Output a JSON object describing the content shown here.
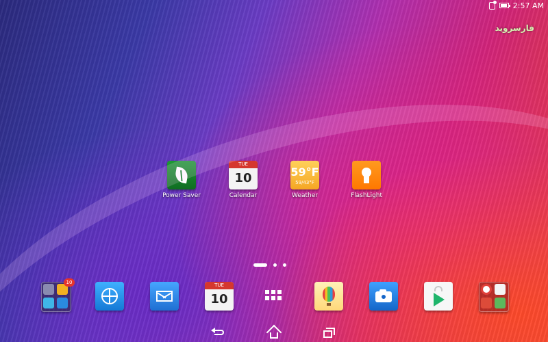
{
  "status_bar": {
    "time": "2:57 AM",
    "icons": [
      "sim-icon",
      "battery-icon"
    ]
  },
  "watermark": {
    "text": "فارسروید"
  },
  "home_apps": [
    {
      "label": "Power Saver",
      "icon": "leaf-icon",
      "color": "#1e9a35"
    },
    {
      "label": "Calendar",
      "icon": "calendar-icon",
      "day": "TUE",
      "date": "10"
    },
    {
      "label": "Weather",
      "icon": "weather-icon",
      "temp": "59°F",
      "range": "59/43°F"
    },
    {
      "label": "FlashLight",
      "icon": "flashlight-icon",
      "color": "#ff8a00"
    }
  ],
  "page_indicator": {
    "pages": 3,
    "active": 0
  },
  "dock": {
    "folder_badge": "10",
    "calendar_day": "TUE",
    "calendar_date": "10",
    "items": [
      "folder-icon",
      "browser-icon",
      "email-icon",
      "calendar-icon",
      "all-apps-icon",
      "gallery-icon",
      "camera-icon",
      "play-store-icon",
      "google-folder-icon"
    ]
  },
  "nav_bar": {
    "buttons": [
      "back-icon",
      "home-icon",
      "recent-apps-icon"
    ]
  }
}
